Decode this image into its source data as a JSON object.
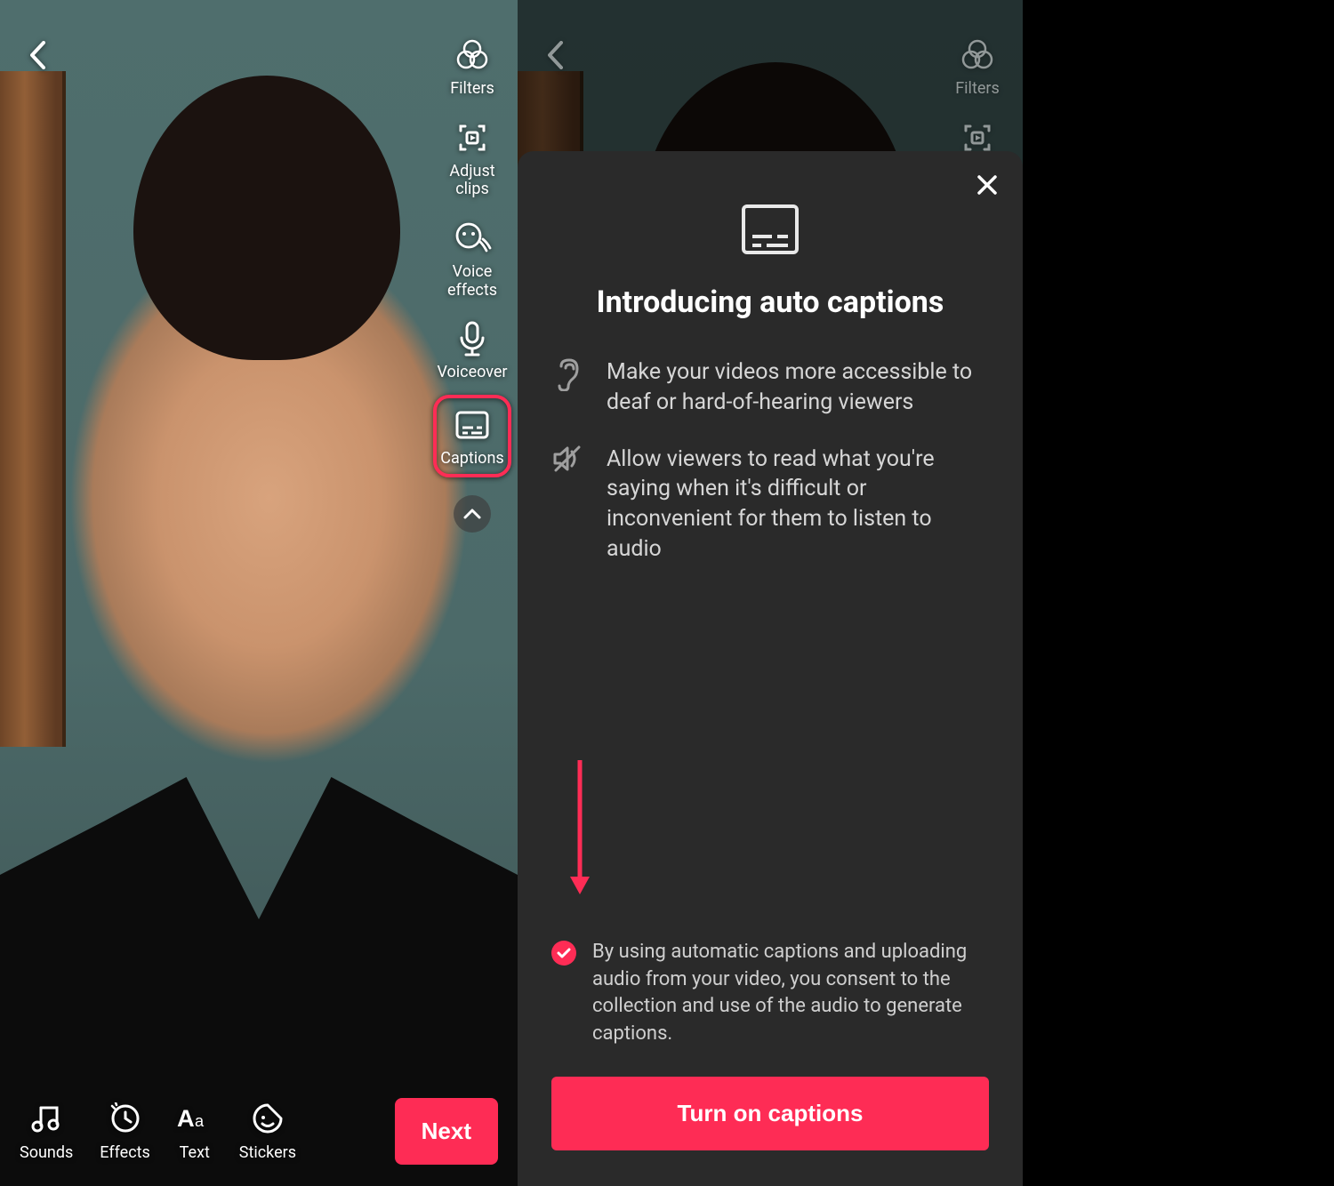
{
  "left": {
    "side_tools": {
      "filters": "Filters",
      "adjust": "Adjust clips",
      "voice_effects": "Voice\neffects",
      "voiceover": "Voiceover",
      "captions": "Captions"
    },
    "bottom_tools": {
      "sounds": "Sounds",
      "effects": "Effects",
      "text": "Text",
      "stickers": "Stickers"
    },
    "next": "Next"
  },
  "right": {
    "side_tools": {
      "filters": "Filters"
    },
    "modal": {
      "title": "Introducing auto captions",
      "bullet1": "Make your videos more accessible to deaf or hard-of-hearing viewers",
      "bullet2": "Allow viewers to read what you're saying when it's difficult or inconvenient for them to listen to audio",
      "consent": "By using automatic captions and uploading audio from your video, you consent to the collection and use of the audio to generate captions.",
      "cta": "Turn on captions"
    }
  }
}
